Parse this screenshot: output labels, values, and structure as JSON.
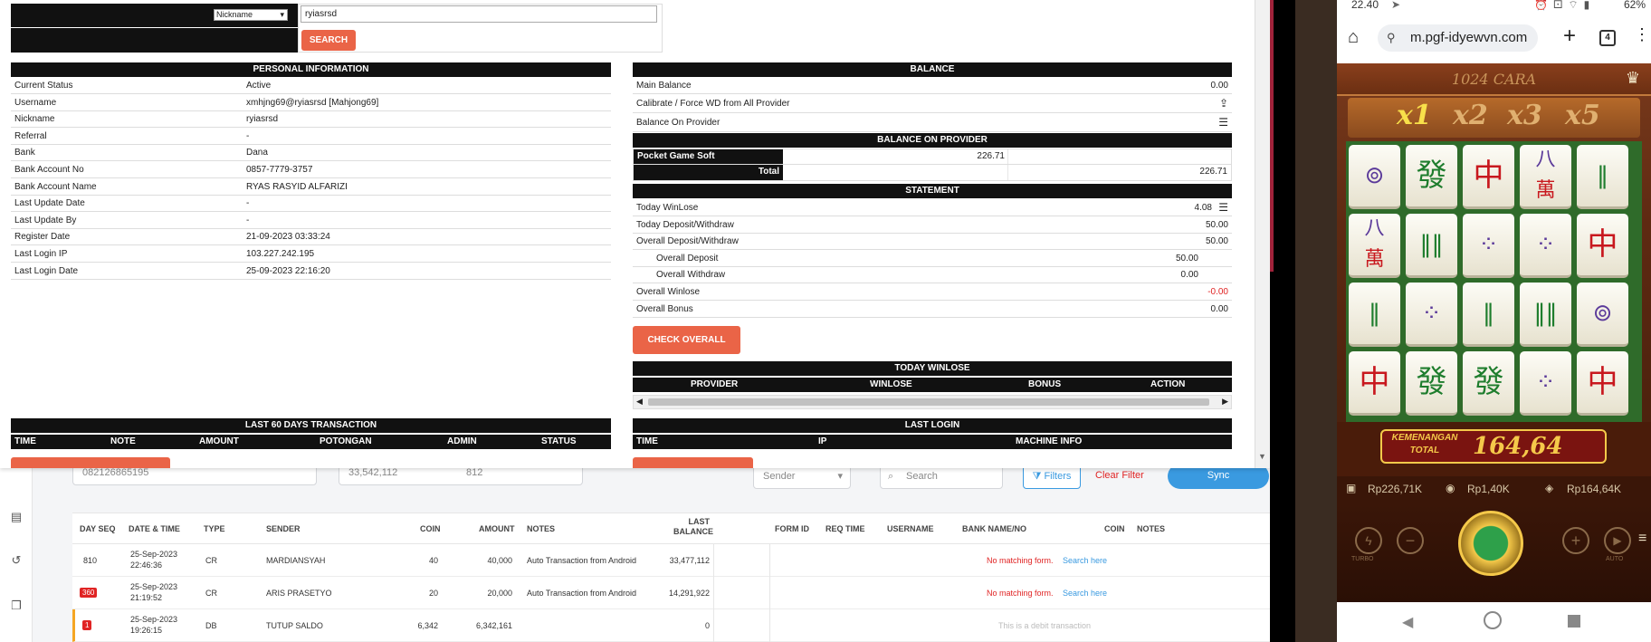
{
  "admin": {
    "search": {
      "select_value": "Nickname",
      "input_value": "ryiasrsd",
      "button_label": "SEARCH"
    },
    "personal_info": {
      "title": "PERSONAL INFORMATION",
      "rows": [
        {
          "label": "Current Status",
          "value": "Active"
        },
        {
          "label": "Username",
          "value": "xmhjng69@ryiasrsd  [Mahjong69]"
        },
        {
          "label": "Nickname",
          "value": "ryiasrsd"
        },
        {
          "label": "Referral",
          "value": "-"
        },
        {
          "label": "Bank",
          "value": "Dana"
        },
        {
          "label": "Bank Account No",
          "value": "0857-7779-3757"
        },
        {
          "label": "Bank Account Name",
          "value": "RYAS RASYID ALFARIZI"
        },
        {
          "label": "Last Update Date",
          "value": "-"
        },
        {
          "label": "Last Update By",
          "value": "-"
        },
        {
          "label": "Register Date",
          "value": "21-09-2023 03:33:24"
        },
        {
          "label": "Last Login IP",
          "value": "103.227.242.195"
        },
        {
          "label": "Last Login Date",
          "value": "25-09-2023 22:16:20"
        }
      ]
    },
    "balance": {
      "title": "BALANCE",
      "main_label": "Main Balance",
      "main_value": "0.00",
      "calibrate_label": "Calibrate / Force WD from All Provider",
      "on_provider_label": "Balance On Provider"
    },
    "balance_provider": {
      "title": "BALANCE ON PROVIDER",
      "provider": "Pocket Game Soft",
      "provider_value": "226.71",
      "total_label": "Total",
      "total_value": "226.71"
    },
    "statement": {
      "title": "STATEMENT",
      "rows": [
        {
          "label": "Today WinLose",
          "value": "4.08"
        },
        {
          "label": "Today Deposit/Withdraw",
          "value": "50.00"
        },
        {
          "label": "Overall Deposit/Withdraw",
          "value": "50.00"
        },
        {
          "label": "Overall Deposit",
          "value": "50.00"
        },
        {
          "label": "Overall Withdraw",
          "value": "0.00"
        },
        {
          "label": "Overall Winlose",
          "value": "-0.00"
        },
        {
          "label": "Overall Bonus",
          "value": "0.00"
        }
      ],
      "check_button": "CHECK OVERALL"
    },
    "today_winlose": {
      "title": "TODAY WINLOSE",
      "columns": [
        "PROVIDER",
        "WINLOSE",
        "BONUS",
        "ACTION"
      ]
    },
    "last60": {
      "title": "LAST 60 DAYS TRANSACTION",
      "columns": [
        "TIME",
        "NOTE",
        "AMOUNT",
        "POTONGAN",
        "ADMIN",
        "STATUS"
      ]
    },
    "last_login": {
      "title": "LAST LOGIN",
      "columns": [
        "TIME",
        "IP",
        "MACHINE INFO"
      ]
    }
  },
  "bank_app": {
    "filters": {
      "account_partial": "082126865195",
      "balance_partial": "33,542,112",
      "count_partial": "812",
      "sender_select": "Sender",
      "search_placeholder": "Search",
      "filters_button": "Filters",
      "clear_filter": "Clear Filter",
      "sync_button": "Sync"
    },
    "columns": [
      "DAY SEQ",
      "DATE & TIME",
      "TYPE",
      "SENDER",
      "COIN",
      "AMOUNT",
      "NOTES",
      "LAST BALANCE",
      "FORM ID",
      "REQ TIME",
      "USERNAME",
      "BANK NAME/NO",
      "COIN",
      "NOTES"
    ],
    "rows": [
      {
        "seq": "810",
        "date": "25-Sep-2023",
        "time": "22:46:36",
        "type": "CR",
        "sender": "MARDIANSYAH",
        "coin": "40",
        "amount": "40,000",
        "notes": "Auto Transaction from Android",
        "last_balance": "33,477,112",
        "match": "No matching form.",
        "link": "Search here"
      },
      {
        "seq": "360",
        "date": "25-Sep-2023",
        "time": "21:19:52",
        "type": "CR",
        "sender": "ARIS PRASETYO",
        "coin": "20",
        "amount": "20,000",
        "notes": "Auto Transaction from Android",
        "last_balance": "14,291,922",
        "match": "No matching form.",
        "link": "Search here"
      },
      {
        "seq": "1",
        "date": "25-Sep-2023",
        "time": "19:26:15",
        "type": "DB",
        "sender": "TUTUP SALDO",
        "coin": "6,342",
        "amount": "6,342,161",
        "notes": "",
        "last_balance": "0",
        "match": "This is a debit transaction",
        "link": ""
      }
    ]
  },
  "phone": {
    "status_time": "22.40",
    "battery": "62%",
    "url": "m.pgf-idyewvn.com",
    "tab_count": "4",
    "game": {
      "title_banner": "1024 CARA",
      "multipliers": [
        "x1",
        "x2",
        "x3",
        "x5"
      ],
      "win_label_1": "KEMENANGAN",
      "win_label_2": "TOTAL",
      "win_value": "164,64",
      "balance": "Rp226,71K",
      "bet": "Rp1,40K",
      "win": "Rp164,64K",
      "turbo_label": "TURBO",
      "auto_label": "AUTO"
    }
  },
  "colors": {
    "accent_orange": "#ea6447",
    "header_black": "#111111",
    "negative_red": "#e02424",
    "sync_blue": "#3a9ae0",
    "game_gold": "#f5c94a"
  }
}
